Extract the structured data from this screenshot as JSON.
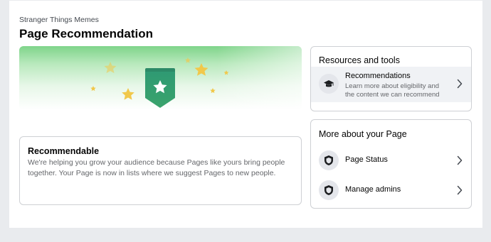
{
  "header": {
    "page_name": "Stranger Things Memes",
    "title": "Page Recommendation"
  },
  "recommendable": {
    "title": "Recommendable",
    "body": "We're helping you grow your audience because Pages like yours bring people together. Your Page is now in lists where we suggest Pages to new people."
  },
  "resources": {
    "title": "Resources and tools",
    "items": [
      {
        "label": "Recommendations",
        "description": "Learn more about eligibility and the content we can recommend",
        "icon": "graduation-cap-icon"
      }
    ]
  },
  "more": {
    "title": "More about your Page",
    "items": [
      {
        "label": "Page Status",
        "icon": "shield-icon"
      },
      {
        "label": "Manage admins",
        "icon": "shield-icon"
      }
    ]
  },
  "colors": {
    "badge_top": "#2f9a73",
    "badge_bottom": "#3aa36c",
    "star_gold": "#f1c84b",
    "hero_green": "#7fd48a"
  }
}
